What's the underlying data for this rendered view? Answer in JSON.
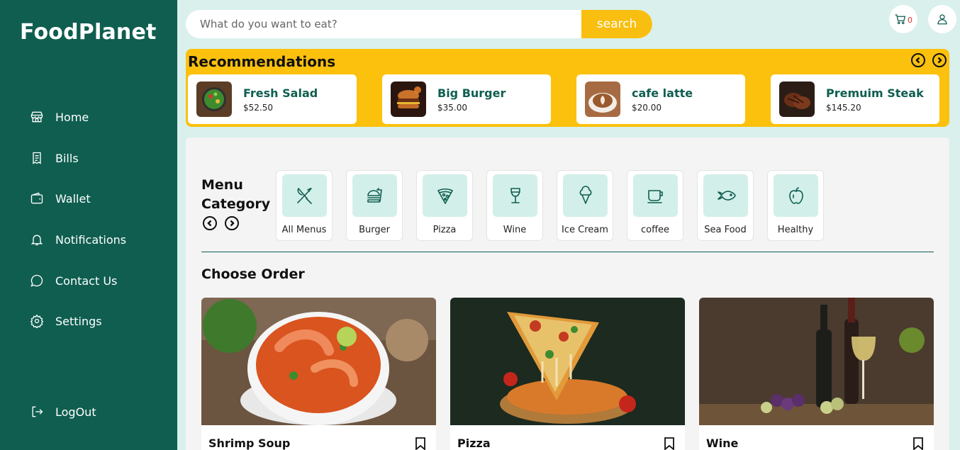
{
  "app": {
    "logo": "FoodPlanet"
  },
  "sidebar": {
    "items": [
      {
        "label": "Home",
        "icon": "store-icon"
      },
      {
        "label": "Bills",
        "icon": "receipt-icon"
      },
      {
        "label": "Wallet",
        "icon": "wallet-icon"
      },
      {
        "label": "Notifications",
        "icon": "bell-icon"
      },
      {
        "label": "Contact Us",
        "icon": "chat-icon"
      },
      {
        "label": "Settings",
        "icon": "gear-icon"
      }
    ],
    "logout": {
      "label": "LogOut",
      "icon": "logout-icon"
    }
  },
  "search": {
    "placeholder": "What do you want to eat?",
    "button_label": "search"
  },
  "header": {
    "cart_count": "0"
  },
  "recommendations": {
    "title": "Recommendations",
    "items": [
      {
        "name": "Fresh Salad",
        "price": "$52.50"
      },
      {
        "name": "Big Burger",
        "price": "$35.00"
      },
      {
        "name": "cafe latte",
        "price": "$20.00"
      },
      {
        "name": "Premuim Steak",
        "price": "$145.20"
      }
    ]
  },
  "menu_category": {
    "title": "Menu Category",
    "items": [
      {
        "label": "All Menus",
        "icon": "fork-knife-icon"
      },
      {
        "label": "Burger",
        "icon": "burger-icon"
      },
      {
        "label": "Pizza",
        "icon": "pizza-icon"
      },
      {
        "label": "Wine",
        "icon": "wine-glass-icon"
      },
      {
        "label": "Ice Cream",
        "icon": "ice-cream-icon"
      },
      {
        "label": "coffee",
        "icon": "coffee-cup-icon"
      },
      {
        "label": "Sea Food",
        "icon": "fish-icon"
      },
      {
        "label": "Healthy",
        "icon": "apple-icon"
      }
    ]
  },
  "choose_order": {
    "title": "Choose Order",
    "items": [
      {
        "name": "Shrimp Soup"
      },
      {
        "name": "Pizza"
      },
      {
        "name": "Wine"
      }
    ]
  },
  "colors": {
    "primary": "#0f5e50",
    "accent": "#fbc10d",
    "background": "#d9f0ec",
    "panel": "#f4f4f4"
  }
}
